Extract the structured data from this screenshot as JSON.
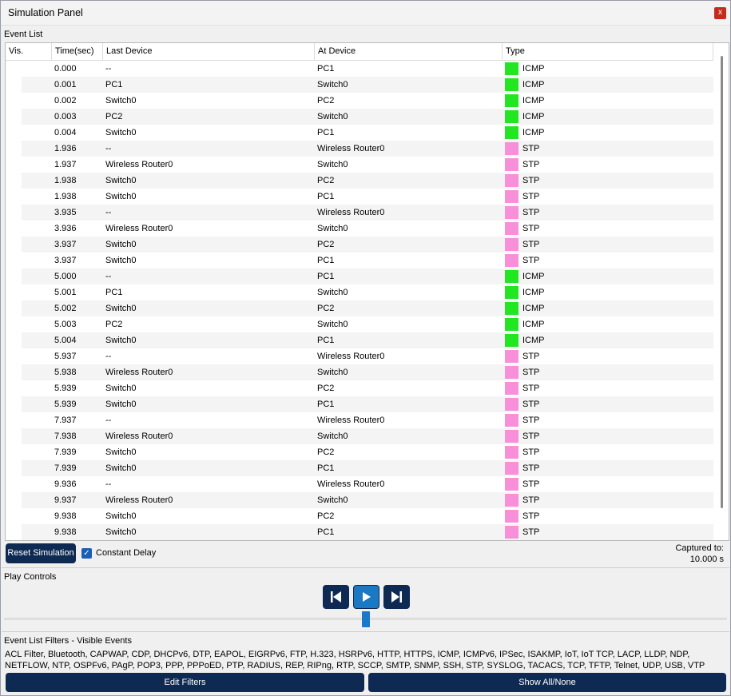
{
  "window": {
    "title": "Simulation Panel",
    "close_label": "x"
  },
  "event_list": {
    "label": "Event List",
    "columns": [
      "Vis.",
      "Time(sec)",
      "Last Device",
      "At Device",
      "Type"
    ],
    "rows": [
      {
        "time": "0.000",
        "last": "--",
        "at": "PC1",
        "type": "ICMP",
        "color": "#22e622"
      },
      {
        "time": "0.001",
        "last": "PC1",
        "at": "Switch0",
        "type": "ICMP",
        "color": "#22e622"
      },
      {
        "time": "0.002",
        "last": "Switch0",
        "at": "PC2",
        "type": "ICMP",
        "color": "#22e622"
      },
      {
        "time": "0.003",
        "last": "PC2",
        "at": "Switch0",
        "type": "ICMP",
        "color": "#22e622"
      },
      {
        "time": "0.004",
        "last": "Switch0",
        "at": "PC1",
        "type": "ICMP",
        "color": "#22e622"
      },
      {
        "time": "1.936",
        "last": "--",
        "at": "Wireless Router0",
        "type": "STP",
        "color": "#f790d8"
      },
      {
        "time": "1.937",
        "last": "Wireless Router0",
        "at": "Switch0",
        "type": "STP",
        "color": "#f790d8"
      },
      {
        "time": "1.938",
        "last": "Switch0",
        "at": "PC2",
        "type": "STP",
        "color": "#f790d8"
      },
      {
        "time": "1.938",
        "last": "Switch0",
        "at": "PC1",
        "type": "STP",
        "color": "#f790d8"
      },
      {
        "time": "3.935",
        "last": "--",
        "at": "Wireless Router0",
        "type": "STP",
        "color": "#f790d8"
      },
      {
        "time": "3.936",
        "last": "Wireless Router0",
        "at": "Switch0",
        "type": "STP",
        "color": "#f790d8"
      },
      {
        "time": "3.937",
        "last": "Switch0",
        "at": "PC2",
        "type": "STP",
        "color": "#f790d8"
      },
      {
        "time": "3.937",
        "last": "Switch0",
        "at": "PC1",
        "type": "STP",
        "color": "#f790d8"
      },
      {
        "time": "5.000",
        "last": "--",
        "at": "PC1",
        "type": "ICMP",
        "color": "#22e622"
      },
      {
        "time": "5.001",
        "last": "PC1",
        "at": "Switch0",
        "type": "ICMP",
        "color": "#22e622"
      },
      {
        "time": "5.002",
        "last": "Switch0",
        "at": "PC2",
        "type": "ICMP",
        "color": "#22e622"
      },
      {
        "time": "5.003",
        "last": "PC2",
        "at": "Switch0",
        "type": "ICMP",
        "color": "#22e622"
      },
      {
        "time": "5.004",
        "last": "Switch0",
        "at": "PC1",
        "type": "ICMP",
        "color": "#22e622"
      },
      {
        "time": "5.937",
        "last": "--",
        "at": "Wireless Router0",
        "type": "STP",
        "color": "#f790d8"
      },
      {
        "time": "5.938",
        "last": "Wireless Router0",
        "at": "Switch0",
        "type": "STP",
        "color": "#f790d8"
      },
      {
        "time": "5.939",
        "last": "Switch0",
        "at": "PC2",
        "type": "STP",
        "color": "#f790d8"
      },
      {
        "time": "5.939",
        "last": "Switch0",
        "at": "PC1",
        "type": "STP",
        "color": "#f790d8"
      },
      {
        "time": "7.937",
        "last": "--",
        "at": "Wireless Router0",
        "type": "STP",
        "color": "#f790d8"
      },
      {
        "time": "7.938",
        "last": "Wireless Router0",
        "at": "Switch0",
        "type": "STP",
        "color": "#f790d8"
      },
      {
        "time": "7.939",
        "last": "Switch0",
        "at": "PC2",
        "type": "STP",
        "color": "#f790d8"
      },
      {
        "time": "7.939",
        "last": "Switch0",
        "at": "PC1",
        "type": "STP",
        "color": "#f790d8"
      },
      {
        "time": "9.936",
        "last": "--",
        "at": "Wireless Router0",
        "type": "STP",
        "color": "#f790d8"
      },
      {
        "time": "9.937",
        "last": "Wireless Router0",
        "at": "Switch0",
        "type": "STP",
        "color": "#f790d8"
      },
      {
        "time": "9.938",
        "last": "Switch0",
        "at": "PC2",
        "type": "STP",
        "color": "#f790d8"
      },
      {
        "time": "9.938",
        "last": "Switch0",
        "at": "PC1",
        "type": "STP",
        "color": "#f790d8"
      }
    ]
  },
  "controls": {
    "reset_label": "Reset Simulation",
    "constant_delay_label": "Constant Delay",
    "constant_delay_checked": true,
    "captured_label": "Captured to:",
    "captured_value": "10.000 s"
  },
  "play_controls": {
    "label": "Play Controls",
    "buttons": [
      "back-icon",
      "play-icon",
      "forward-icon"
    ]
  },
  "filters": {
    "label": "Event List Filters - Visible Events",
    "text": "ACL Filter, Bluetooth, CAPWAP, CDP, DHCPv6, DTP, EAPOL, EIGRPv6, FTP, H.323, HSRPv6, HTTP, HTTPS, ICMP, ICMPv6, IPSec, ISAKMP, IoT, IoT TCP, LACP, LLDP, NDP, NETFLOW, NTP, OSPFv6, PAgP, POP3, PPP, PPPoED, PTP, RADIUS, REP, RIPng, RTP, SCCP, SMTP, SNMP, SSH, STP, SYSLOG, TACACS, TCP, TFTP, Telnet, UDP, USB, VTP",
    "edit_label": "Edit Filters",
    "show_all_label": "Show All/None"
  }
}
